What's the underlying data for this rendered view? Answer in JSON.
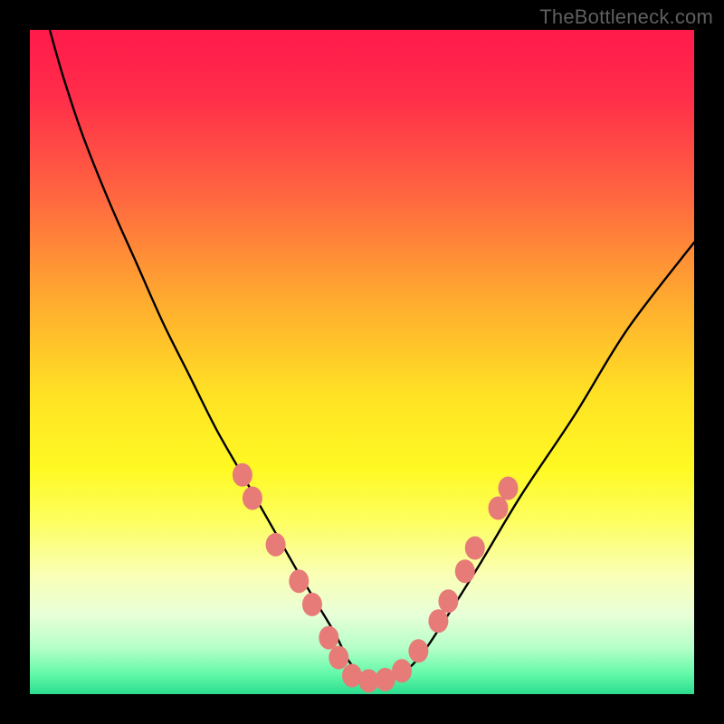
{
  "watermark": "TheBottleneck.com",
  "colors": {
    "gradient_stops": [
      {
        "offset": 0.0,
        "color": "#ff1a4b"
      },
      {
        "offset": 0.1,
        "color": "#ff2d4a"
      },
      {
        "offset": 0.25,
        "color": "#ff6640"
      },
      {
        "offset": 0.4,
        "color": "#ffa830"
      },
      {
        "offset": 0.55,
        "color": "#ffe224"
      },
      {
        "offset": 0.66,
        "color": "#fff923"
      },
      {
        "offset": 0.74,
        "color": "#fdff60"
      },
      {
        "offset": 0.82,
        "color": "#faffb5"
      },
      {
        "offset": 0.88,
        "color": "#e8ffd8"
      },
      {
        "offset": 0.93,
        "color": "#b6ffc8"
      },
      {
        "offset": 0.97,
        "color": "#62f9a9"
      },
      {
        "offset": 1.0,
        "color": "#2cdc8e"
      }
    ],
    "curve": "#000000",
    "marker_fill": "#e77b78",
    "marker_stroke": "#c75d5c"
  },
  "chart_data": {
    "type": "line",
    "title": "",
    "xlabel": "",
    "ylabel": "",
    "xlim": [
      0,
      100
    ],
    "ylim": [
      0,
      100
    ],
    "series": [
      {
        "name": "curve",
        "x": [
          3,
          5,
          8,
          12,
          16,
          20,
          24,
          28,
          32,
          36,
          40,
          43,
          46,
          48,
          50,
          52,
          54,
          56,
          59,
          63,
          68,
          74,
          82,
          90,
          100
        ],
        "y": [
          100,
          93,
          84,
          74,
          65,
          56,
          48,
          40,
          33,
          26,
          19,
          14,
          9,
          5,
          3,
          2,
          2,
          3,
          6,
          12,
          20,
          30,
          42,
          55,
          68
        ]
      }
    ],
    "markers": [
      {
        "x": 32.0,
        "y": 33.0
      },
      {
        "x": 33.5,
        "y": 29.5
      },
      {
        "x": 37.0,
        "y": 22.5
      },
      {
        "x": 40.5,
        "y": 17.0
      },
      {
        "x": 42.5,
        "y": 13.5
      },
      {
        "x": 45.0,
        "y": 8.5
      },
      {
        "x": 46.5,
        "y": 5.5
      },
      {
        "x": 48.5,
        "y": 2.8
      },
      {
        "x": 51.0,
        "y": 2.0
      },
      {
        "x": 53.5,
        "y": 2.2
      },
      {
        "x": 56.0,
        "y": 3.5
      },
      {
        "x": 58.5,
        "y": 6.5
      },
      {
        "x": 61.5,
        "y": 11.0
      },
      {
        "x": 63.0,
        "y": 14.0
      },
      {
        "x": 65.5,
        "y": 18.5
      },
      {
        "x": 67.0,
        "y": 22.0
      },
      {
        "x": 70.5,
        "y": 28.0
      },
      {
        "x": 72.0,
        "y": 31.0
      }
    ]
  }
}
